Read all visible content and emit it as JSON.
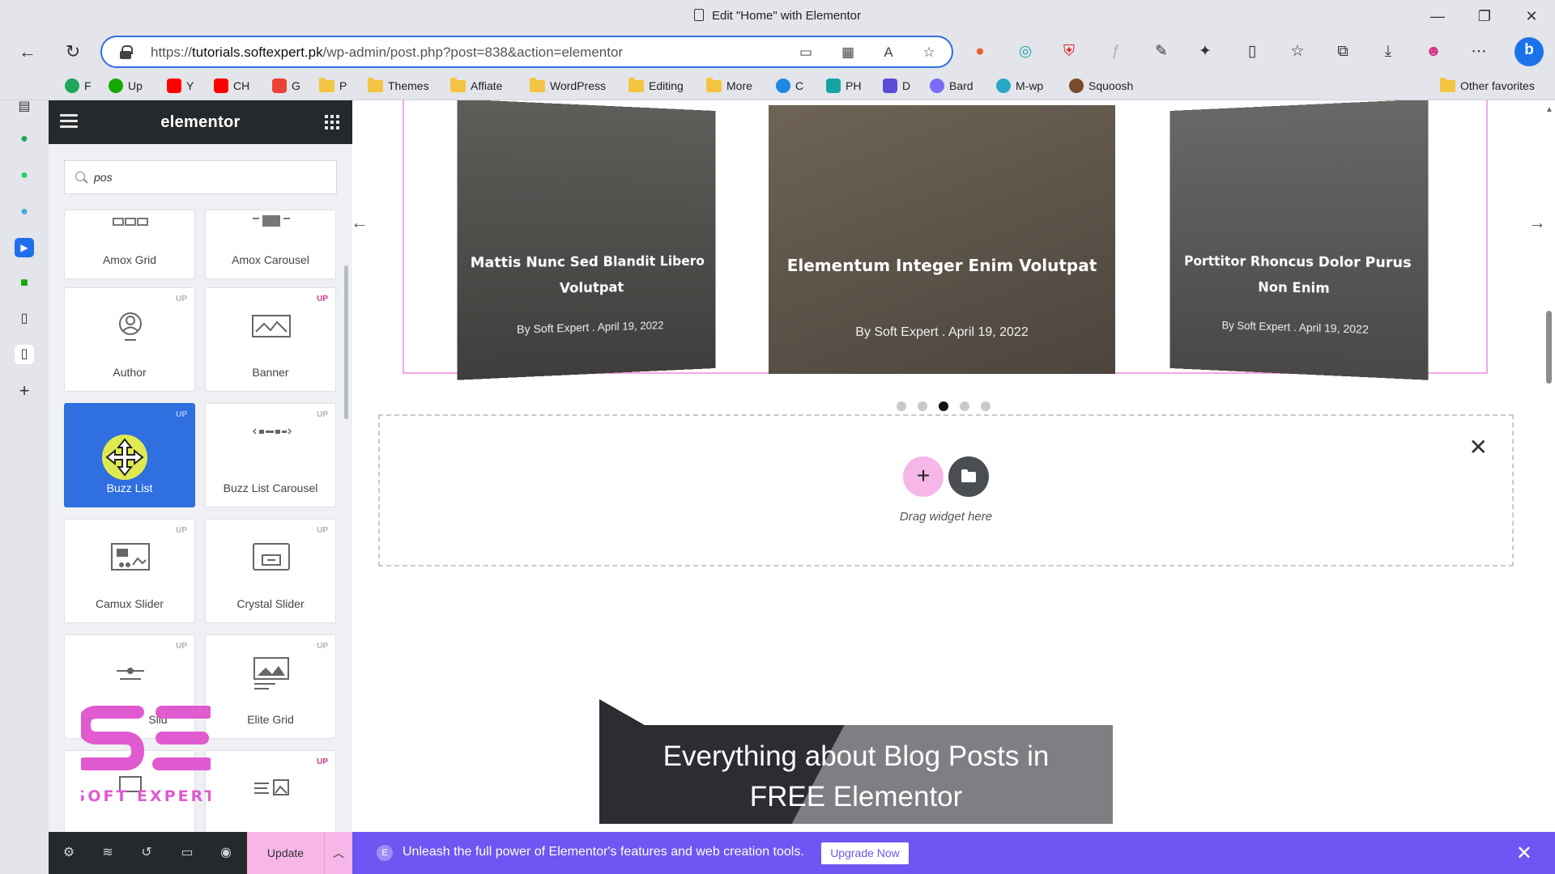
{
  "window": {
    "title": "Edit \"Home\" with Elementor",
    "controls": {
      "minimize": "—",
      "restore": "❐",
      "close": "✕"
    }
  },
  "browser": {
    "url_prefix": "https://",
    "url_domain": "tutorials.softexpert.pk",
    "url_path": "/wp-admin/post.php?post=838&action=elementor",
    "bookmarks": [
      "F",
      "Up",
      "Y",
      "CH",
      "G",
      "P",
      "Themes",
      "Affiate",
      "WordPress",
      "Editing",
      "More",
      "C",
      "PH",
      "D",
      "Bard",
      "M-wp",
      "Squoosh"
    ],
    "other_favorites": "Other favorites"
  },
  "panel": {
    "logo": "elementor",
    "search_value": "pos",
    "widgets": [
      {
        "label": "Amox Grid",
        "icon": "grid-layout-icon",
        "pro": false
      },
      {
        "label": "Amox Carousel",
        "icon": "carousel-icon",
        "pro": false
      },
      {
        "label": "Author",
        "icon": "user-icon",
        "pro": true
      },
      {
        "label": "Banner",
        "icon": "image-banner-icon",
        "pro": true
      },
      {
        "label": "Buzz List",
        "icon": "list-icon",
        "pro": true
      },
      {
        "label": "Buzz List Carousel",
        "icon": "carousel-icon",
        "pro": true
      },
      {
        "label": "Camux Slider",
        "icon": "slider-icon",
        "pro": true
      },
      {
        "label": "Crystal Slider",
        "icon": "slider-icon",
        "pro": true
      },
      {
        "label": "Slid",
        "icon": "slider-icon",
        "pro": true
      },
      {
        "label": "Elite Grid",
        "icon": "image-grid-icon",
        "pro": true
      },
      {
        "label": "",
        "icon": "carousel-icon",
        "pro": true
      },
      {
        "label": "",
        "icon": "image-list-icon",
        "pro": true
      }
    ],
    "update_label": "Update"
  },
  "canvas": {
    "slides": [
      {
        "title": "Mattis Nunc Sed Blandit Libero Volutpat",
        "meta": "By Soft Expert . April 19, 2022"
      },
      {
        "title": "Elementum Integer Enim Volutpat",
        "meta": "By Soft Expert . April 19, 2022"
      },
      {
        "title": "Porttitor Rhoncus Dolor Purus Non Enim",
        "meta": "By Soft Expert . April 19, 2022"
      }
    ],
    "active_dot": 3,
    "dot_count": 5,
    "drag_text": "Drag widget here"
  },
  "overlay": {
    "video_title_line1": "Everything about Blog Posts in",
    "video_title_line2": "FREE Elementor",
    "watermark": "SOFT EXPERT"
  },
  "promo": {
    "text": "Unleash the full power of Elementor's features and web creation tools.",
    "button": "Upgrade Now"
  },
  "colors": {
    "accent": "#2f6fdf",
    "elementor_pink": "#f6b6e8",
    "promo": "#6f55f1",
    "panel_dark": "#26292c"
  }
}
